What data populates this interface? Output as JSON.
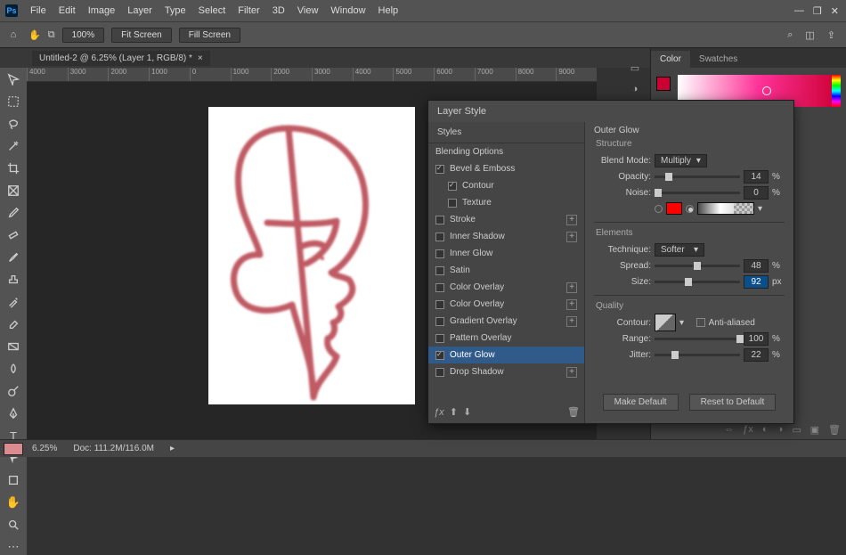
{
  "menu": {
    "items": [
      "File",
      "Edit",
      "Image",
      "Layer",
      "Type",
      "Select",
      "Filter",
      "3D",
      "View",
      "Window",
      "Help"
    ]
  },
  "optbar": {
    "zoom": "100%",
    "fit": "Fit Screen",
    "fill": "Fill Screen"
  },
  "doc": {
    "title": "Untitled-2 @ 6.25% (Layer 1, RGB/8) *"
  },
  "ruler": {
    "ticks": [
      "4000",
      "3000",
      "2000",
      "1000",
      "0",
      "1000",
      "2000",
      "3000",
      "4000",
      "5000",
      "6000",
      "7000",
      "8000",
      "9000"
    ]
  },
  "status": {
    "zoom": "6.25%",
    "docinfo": "Doc: 111.2M/116.0M"
  },
  "panels": {
    "tab1": "Color",
    "tab2": "Swatches"
  },
  "dialog": {
    "title": "Layer Style",
    "leftHeader": "Styles",
    "list": {
      "blending": "Blending Options",
      "bevel": "Bevel & Emboss",
      "contour": "Contour",
      "texture": "Texture",
      "stroke": "Stroke",
      "innerShadow": "Inner Shadow",
      "innerGlow": "Inner Glow",
      "satin": "Satin",
      "colorOverlay": "Color Overlay",
      "colorOverlay2": "Color Overlay",
      "gradientOverlay": "Gradient Overlay",
      "patternOverlay": "Pattern Overlay",
      "outerGlow": "Outer Glow",
      "dropShadow": "Drop Shadow"
    },
    "section": "Outer Glow",
    "structure": {
      "heading": "Structure",
      "blendLabel": "Blend Mode:",
      "blendValue": "Multiply",
      "opacityLabel": "Opacity:",
      "opacityValue": "14",
      "noiseLabel": "Noise:",
      "noiseValue": "0",
      "pct": "%"
    },
    "elements": {
      "heading": "Elements",
      "techLabel": "Technique:",
      "techValue": "Softer",
      "spreadLabel": "Spread:",
      "spreadValue": "48",
      "sizeLabel": "Size:",
      "sizeValue": "92",
      "px": "px",
      "pct": "%"
    },
    "quality": {
      "heading": "Quality",
      "contourLabel": "Contour:",
      "aa": "Anti-aliased",
      "rangeLabel": "Range:",
      "rangeValue": "100",
      "jitterLabel": "Jitter:",
      "jitterValue": "22",
      "pct": "%"
    },
    "buttons": {
      "makeDefault": "Make Default",
      "reset": "Reset to Default"
    }
  }
}
